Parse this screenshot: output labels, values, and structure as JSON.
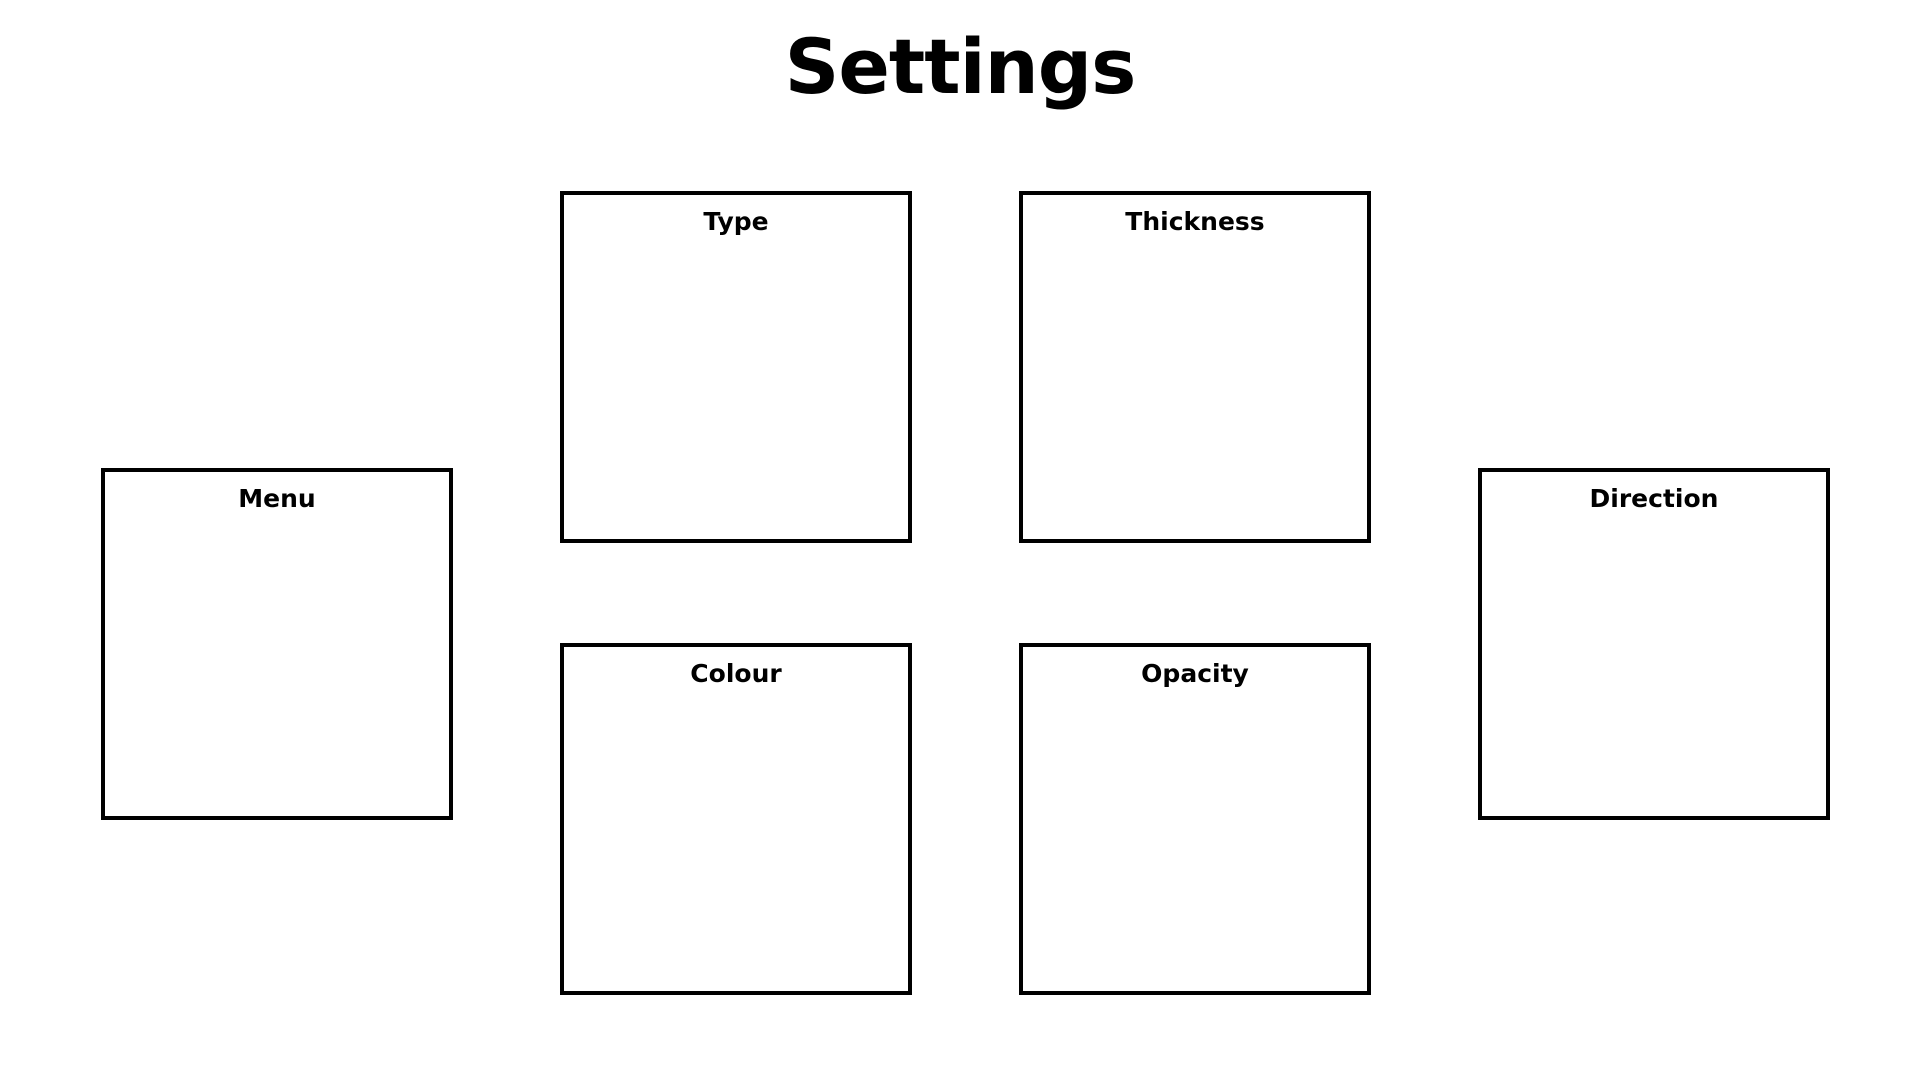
{
  "page": {
    "title": "Settings"
  },
  "panels": {
    "menu": {
      "label": "Menu"
    },
    "type": {
      "label": "Type"
    },
    "thickness": {
      "label": "Thickness"
    },
    "colour": {
      "label": "Colour"
    },
    "opacity": {
      "label": "Opacity"
    },
    "direction": {
      "label": "Direction"
    }
  },
  "colors": {
    "background": "#ffffff",
    "border": "#000000",
    "text": "#000000"
  }
}
